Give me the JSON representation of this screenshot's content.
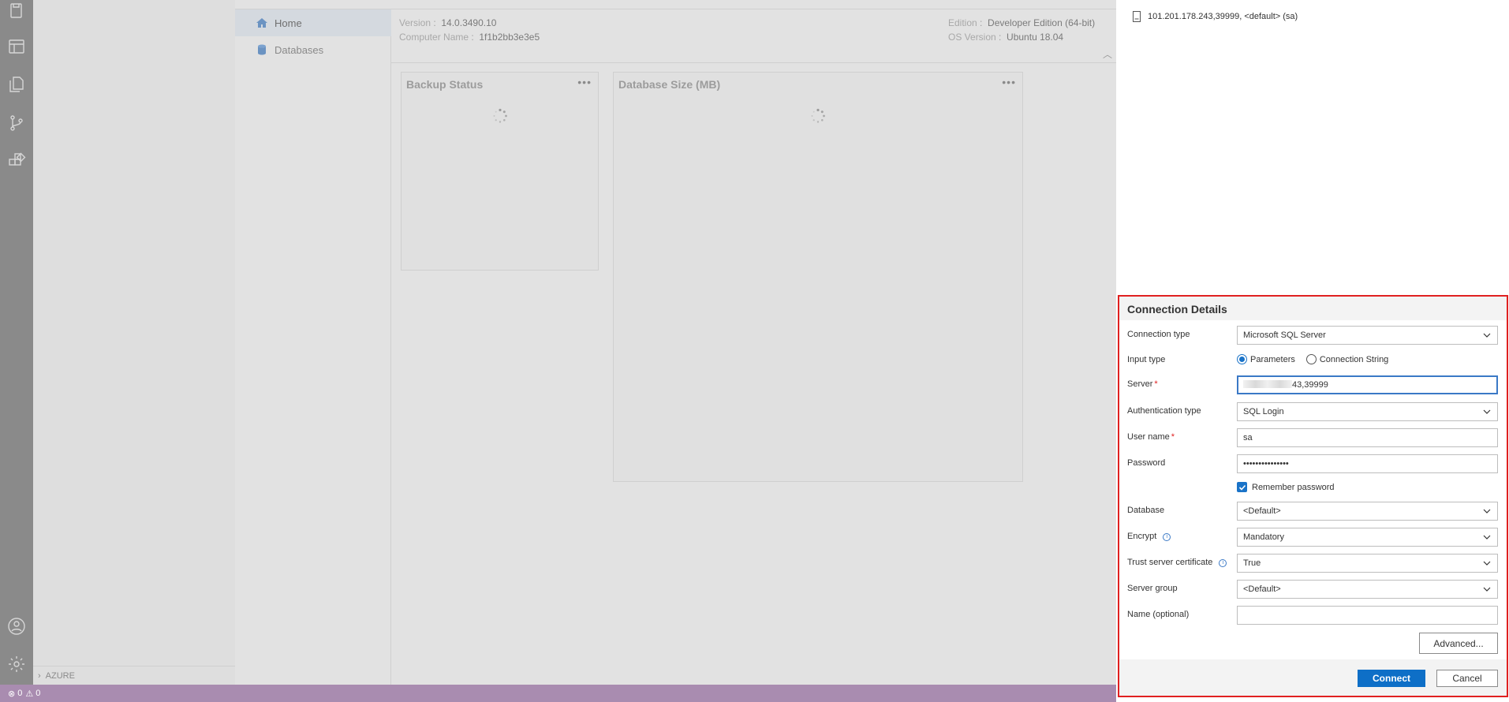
{
  "sidebar": {
    "section_label": "AZURE"
  },
  "editor": {
    "nav": [
      {
        "label": "Home"
      },
      {
        "label": "Databases"
      }
    ],
    "info": {
      "version_label": "Version",
      "version_value": "14.0.3490.10",
      "computer_label": "Computer Name",
      "computer_value": "1f1b2bb3e3e5",
      "edition_label": "Edition",
      "edition_value": "Developer Edition (64-bit)",
      "os_label": "OS Version",
      "os_value": "Ubuntu 18.04"
    },
    "widgets": [
      {
        "title": "Backup Status",
        "menu": "•••"
      },
      {
        "title": "Database Size (MB)",
        "menu": "•••"
      }
    ]
  },
  "recent": {
    "item": "101.201.178.243,39999, <default> (sa)"
  },
  "dialog": {
    "title": "Connection Details",
    "connection_type_label": "Connection type",
    "connection_type_value": "Microsoft SQL Server",
    "input_type_label": "Input type",
    "input_type_options": [
      "Parameters",
      "Connection String"
    ],
    "server_label": "Server",
    "server_value_visible": "43,39999",
    "auth_label": "Authentication type",
    "auth_value": "SQL Login",
    "username_label": "User name",
    "username_value": "sa",
    "password_label": "Password",
    "password_value": "•••••••••••••••",
    "remember_label": "Remember password",
    "database_label": "Database",
    "database_value": "<Default>",
    "encrypt_label": "Encrypt",
    "encrypt_value": "Mandatory",
    "trust_label": "Trust server certificate",
    "trust_value": "True",
    "group_label": "Server group",
    "group_value": "<Default>",
    "name_label": "Name (optional)",
    "name_value": "",
    "advanced_label": "Advanced...",
    "connect_label": "Connect",
    "cancel_label": "Cancel",
    "required_mark": "*",
    "info_mark": "i"
  },
  "status": {
    "errors": "0",
    "warnings": "0"
  },
  "colors": {
    "accent": "#0e6fc7",
    "highlight_border": "#e02020",
    "status_bar": "#a98cb0",
    "activity_bar": "#8a8a8a"
  }
}
